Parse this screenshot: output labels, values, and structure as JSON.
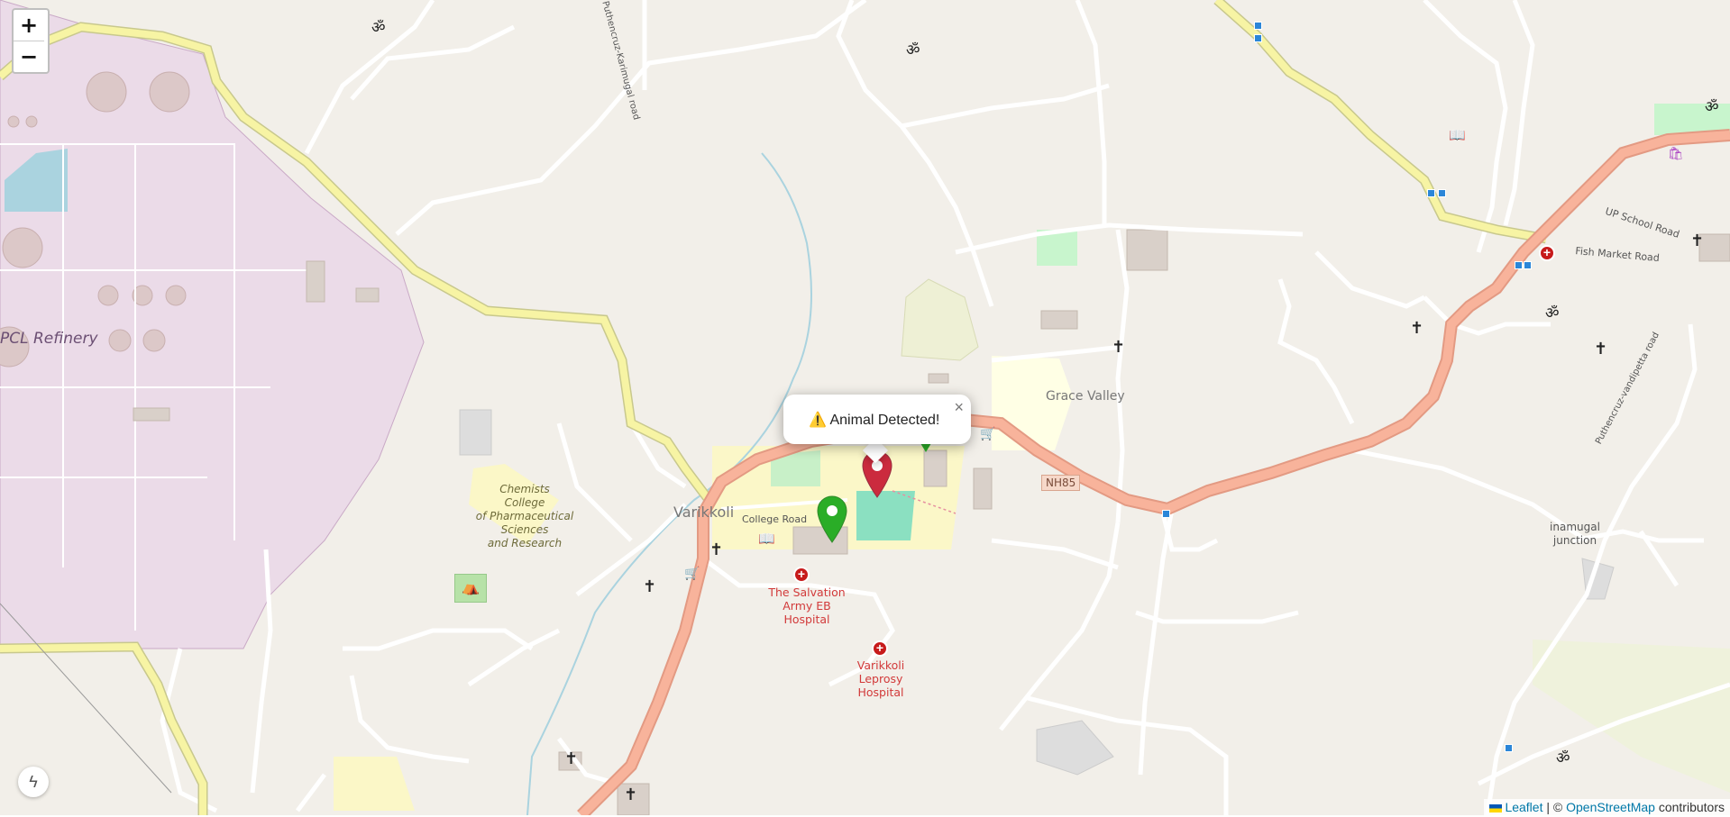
{
  "map": {
    "places": {
      "varikkoli": "Varikkoli",
      "grace_valley": "Grace Valley",
      "refinery": "PCL Refinery",
      "college_lines": [
        "Chemists",
        "College",
        "of Pharmaceutical",
        "Sciences",
        "and Research"
      ],
      "salvation_lines": [
        "The Salvation",
        "Army EB",
        "Hospital"
      ],
      "leprosy_lines": [
        "Varikkoli",
        "Leprosy",
        "Hospital"
      ],
      "junction_lines": [
        "inamugal",
        "junction"
      ]
    },
    "roads": {
      "college_road": "College Road",
      "up_school_road": "UP School Road",
      "fish_market_road": "Fish Market Road",
      "karimugal_road": "Puthencruz-Karimugal road",
      "vandipetta_road": "Puthencruz-vandipetta road",
      "nh": "NH85"
    },
    "colors": {
      "background": "#f2efe9",
      "trunk_road": "#f8b39b",
      "secondary_road": "#f7f4a4",
      "industrial": "#ebdbe8",
      "water": "#aad3df",
      "alert_marker": "#cb2b3e",
      "ok_marker": "#2aad27"
    }
  },
  "controls": {
    "zoom_in": "+",
    "zoom_out": "−",
    "locate_icon": "bolt-icon"
  },
  "popup": {
    "icon": "⚠️",
    "text": "Animal Detected!",
    "close": "×"
  },
  "attribution": {
    "leaflet": "Leaflet",
    "separator": " | © ",
    "osm": "OpenStreetMap",
    "suffix": " contributors"
  }
}
